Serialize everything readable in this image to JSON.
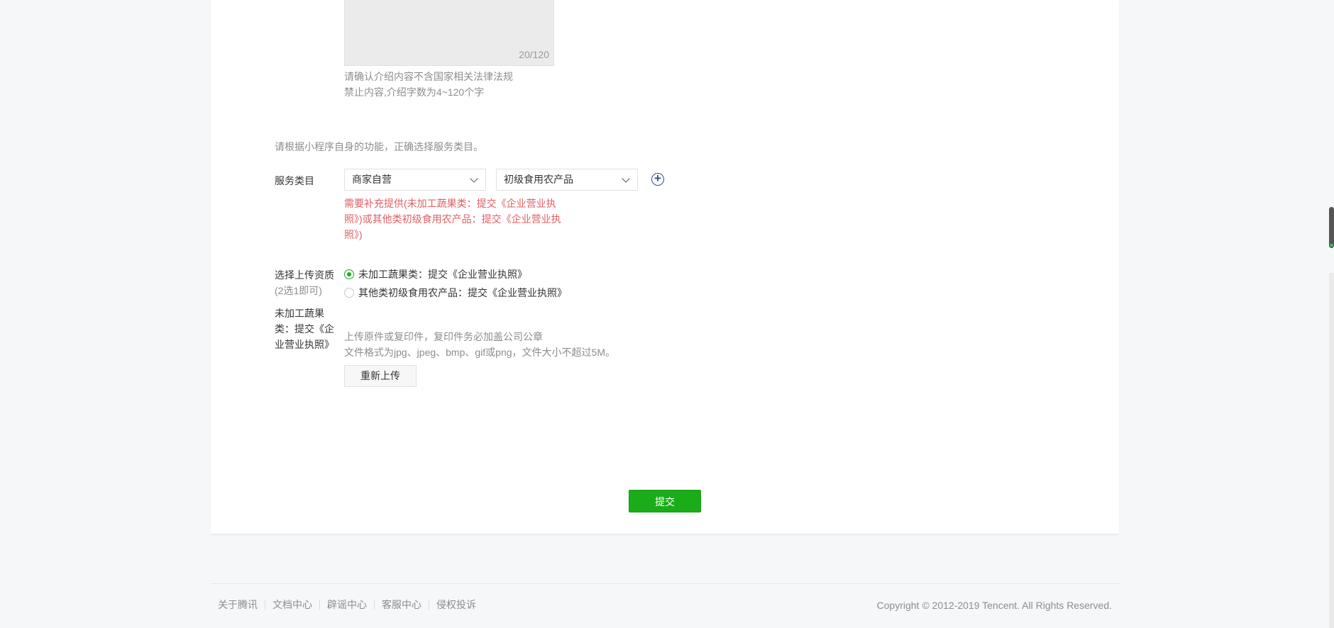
{
  "intro": {
    "counter": "20/120",
    "tip_line1": "请确认介绍内容不含国家相关法律法规",
    "tip_line2": "禁止内容,介绍字数为4~120个字"
  },
  "category": {
    "hint": "请根据小程序自身的功能，正确选择服务类目。",
    "label": "服务类目",
    "select1": "商家自营",
    "select2": "初级食用农产品",
    "add_icon": "plus-circle-icon",
    "error": "需要补充提供(未加工蔬果类：提交《企业营业执照》)或其他类初级食用农产品：提交《企业营业执照》)"
  },
  "qualification": {
    "label": "选择上传资质",
    "sublabel": "(2选1即可)",
    "option1": "未加工蔬果类：提交《企业营业执照》",
    "option2": "其他类初级食用农产品：提交《企业营业执照》",
    "selected": 0
  },
  "upload": {
    "label": "未加工蔬果类：提交《企业营业执照》",
    "tip1": "上传原件或复印件，复印件务必加盖公司公章",
    "tip2": "文件格式为jpg、jpeg、bmp、gif或png，文件大小不超过5M。",
    "button": "重新上传"
  },
  "submit": "提交",
  "footer": {
    "links": [
      "关于腾讯",
      "文档中心",
      "辟谣中心",
      "客服中心",
      "侵权投诉"
    ],
    "copyright": "Copyright © 2012-2019 Tencent. All Rights Reserved."
  },
  "colors": {
    "accent": "#1aad19",
    "error": "#e15f63",
    "link": "#2f4f8f"
  }
}
